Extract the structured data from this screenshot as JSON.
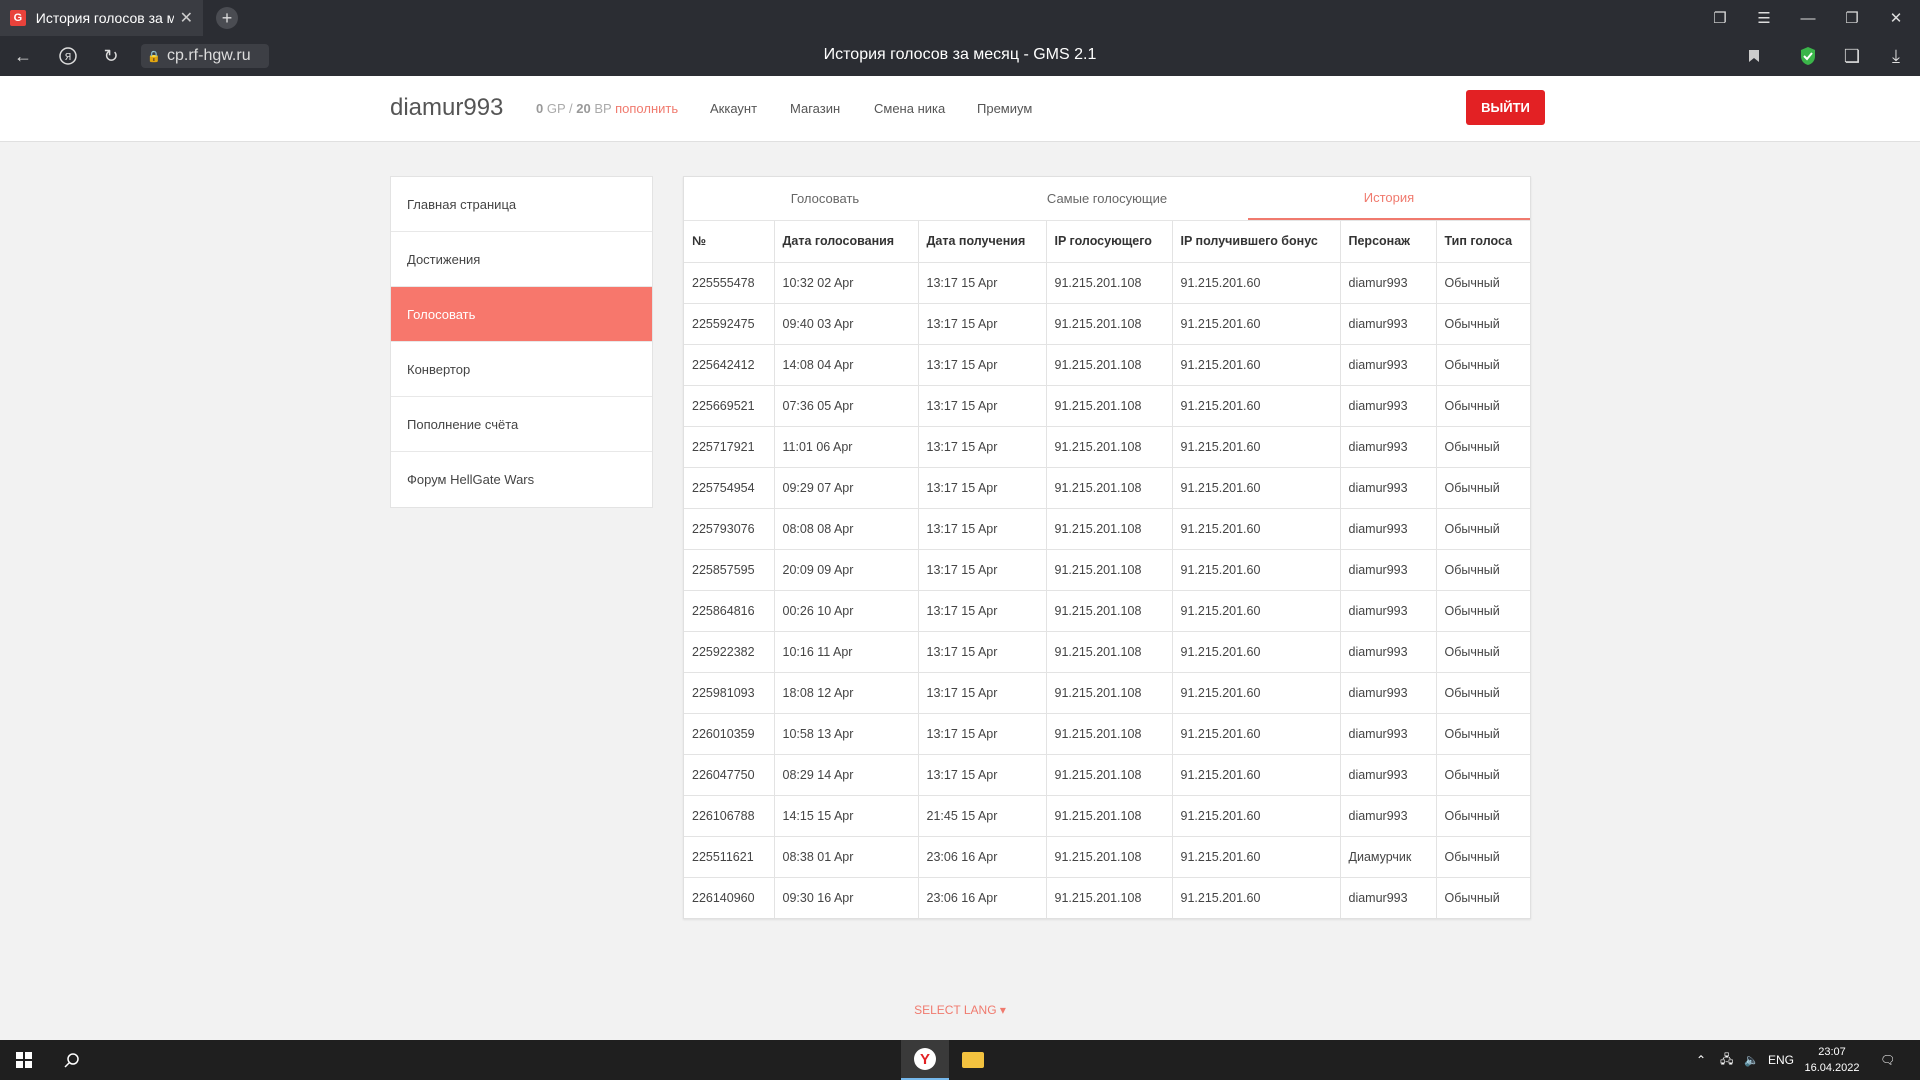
{
  "browser": {
    "tab_title": "История голосов за месяц - GMS 2.1",
    "tab_favicon": "G",
    "url": "cp.rf-hgw.ru",
    "page_title": "История голосов за месяц - GMS 2.1"
  },
  "header": {
    "username": "diamur993",
    "gp_value": "0",
    "gp_unit": "GP",
    "separator": "/",
    "bp_value": "20",
    "bp_unit": "BP",
    "topup_label": "пополнить",
    "nav": [
      "Аккаунт",
      "Магазин",
      "Смена ника",
      "Премиум"
    ],
    "logout_label": "ВЫЙТИ"
  },
  "sidebar": {
    "items": [
      {
        "label": "Главная страница",
        "active": false
      },
      {
        "label": "Достижения",
        "active": false
      },
      {
        "label": "Голосовать",
        "active": true
      },
      {
        "label": "Конвертор",
        "active": false
      },
      {
        "label": "Пополнение счёта",
        "active": false
      },
      {
        "label": "Форум HellGate Wars",
        "active": false
      }
    ]
  },
  "panel": {
    "tabs": [
      {
        "label": "Голосовать",
        "active": false
      },
      {
        "label": "Самые голосующие",
        "active": false
      },
      {
        "label": "История",
        "active": true
      }
    ],
    "columns": [
      "№",
      "Дата голосования",
      "Дата получения",
      "IP голосующего",
      "IP получившего бонус",
      "Персонаж",
      "Тип голоса"
    ],
    "rows": [
      [
        "225555478",
        "10:32 02 Apr",
        "13:17 15 Apr",
        "91.215.201.108",
        "91.215.201.60",
        "diamur993",
        "Обычный"
      ],
      [
        "225592475",
        "09:40 03 Apr",
        "13:17 15 Apr",
        "91.215.201.108",
        "91.215.201.60",
        "diamur993",
        "Обычный"
      ],
      [
        "225642412",
        "14:08 04 Apr",
        "13:17 15 Apr",
        "91.215.201.108",
        "91.215.201.60",
        "diamur993",
        "Обычный"
      ],
      [
        "225669521",
        "07:36 05 Apr",
        "13:17 15 Apr",
        "91.215.201.108",
        "91.215.201.60",
        "diamur993",
        "Обычный"
      ],
      [
        "225717921",
        "11:01 06 Apr",
        "13:17 15 Apr",
        "91.215.201.108",
        "91.215.201.60",
        "diamur993",
        "Обычный"
      ],
      [
        "225754954",
        "09:29 07 Apr",
        "13:17 15 Apr",
        "91.215.201.108",
        "91.215.201.60",
        "diamur993",
        "Обычный"
      ],
      [
        "225793076",
        "08:08 08 Apr",
        "13:17 15 Apr",
        "91.215.201.108",
        "91.215.201.60",
        "diamur993",
        "Обычный"
      ],
      [
        "225857595",
        "20:09 09 Apr",
        "13:17 15 Apr",
        "91.215.201.108",
        "91.215.201.60",
        "diamur993",
        "Обычный"
      ],
      [
        "225864816",
        "00:26 10 Apr",
        "13:17 15 Apr",
        "91.215.201.108",
        "91.215.201.60",
        "diamur993",
        "Обычный"
      ],
      [
        "225922382",
        "10:16 11 Apr",
        "13:17 15 Apr",
        "91.215.201.108",
        "91.215.201.60",
        "diamur993",
        "Обычный"
      ],
      [
        "225981093",
        "18:08 12 Apr",
        "13:17 15 Apr",
        "91.215.201.108",
        "91.215.201.60",
        "diamur993",
        "Обычный"
      ],
      [
        "226010359",
        "10:58 13 Apr",
        "13:17 15 Apr",
        "91.215.201.108",
        "91.215.201.60",
        "diamur993",
        "Обычный"
      ],
      [
        "226047750",
        "08:29 14 Apr",
        "13:17 15 Apr",
        "91.215.201.108",
        "91.215.201.60",
        "diamur993",
        "Обычный"
      ],
      [
        "226106788",
        "14:15 15 Apr",
        "21:45 15 Apr",
        "91.215.201.108",
        "91.215.201.60",
        "diamur993",
        "Обычный"
      ],
      [
        "225511621",
        "08:38 01 Apr",
        "23:06 16 Apr",
        "91.215.201.108",
        "91.215.201.60",
        "Диамурчик",
        "Обычный"
      ],
      [
        "226140960",
        "09:30 16 Apr",
        "23:06 16 Apr",
        "91.215.201.108",
        "91.215.201.60",
        "diamur993",
        "Обычный"
      ]
    ]
  },
  "footer": {
    "select_lang": "SELECT LANG"
  },
  "taskbar": {
    "lang": "ENG",
    "time": "23:07",
    "date": "16.04.2022"
  },
  "colors": {
    "accent": "#f7776c",
    "logout": "#e32124",
    "chrome": "#2b2d33"
  }
}
